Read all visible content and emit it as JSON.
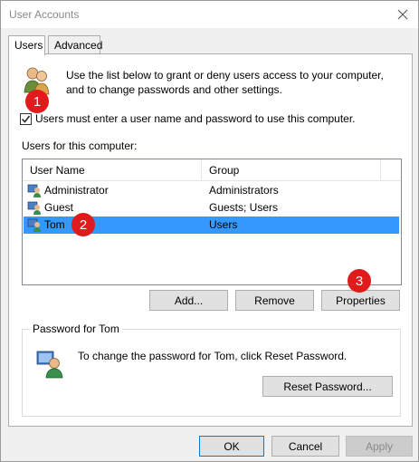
{
  "window": {
    "title": "User Accounts"
  },
  "tabs": [
    {
      "label": "Users",
      "active": true
    },
    {
      "label": "Advanced",
      "active": false
    }
  ],
  "intro": "Use the list below to grant or deny users access to your computer, and to change passwords and other settings.",
  "checkbox": {
    "label": "Users must enter a user name and password to use this computer.",
    "checked": true
  },
  "users_section_label": "Users for this computer:",
  "table": {
    "columns": [
      "User Name",
      "Group"
    ],
    "rows": [
      {
        "name": "Administrator",
        "group": "Administrators",
        "selected": false
      },
      {
        "name": "Guest",
        "group": "Guests; Users",
        "selected": false
      },
      {
        "name": "Tom",
        "group": "Users",
        "selected": true
      }
    ]
  },
  "buttons": {
    "add": "Add...",
    "remove": "Remove",
    "properties": "Properties"
  },
  "password_group": {
    "title": "Password for Tom",
    "text": "To change the password for Tom, click Reset Password.",
    "reset_button": "Reset Password..."
  },
  "footer": {
    "ok": "OK",
    "cancel": "Cancel",
    "apply": "Apply"
  },
  "annotations": [
    "1",
    "2",
    "3"
  ],
  "colors": {
    "selection": "#3399ff",
    "badge": "#e01b1b",
    "default_button_border": "#0078d7"
  }
}
